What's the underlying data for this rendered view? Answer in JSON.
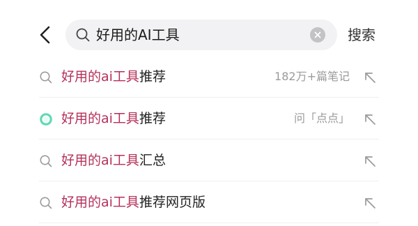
{
  "search": {
    "query": "好用的AI工具",
    "submit_label": "搜索"
  },
  "suggestions": [
    {
      "highlight": "好用的ai工具",
      "rest": "推荐",
      "meta": "182万+篇笔记",
      "icon": "search-icon"
    },
    {
      "highlight": "好用的ai工具",
      "rest": "推荐",
      "meta": "问「点点」",
      "icon": "diandian-ai-icon"
    },
    {
      "highlight": "好用的ai工具",
      "rest": "汇总",
      "meta": "",
      "icon": "search-icon"
    },
    {
      "highlight": "好用的ai工具",
      "rest": "推荐网页版",
      "meta": "",
      "icon": "search-icon"
    }
  ],
  "colors": {
    "highlight": "#b5305a",
    "diandian_ring": "#5fd9b5",
    "search_bg": "#f2f2f4"
  }
}
